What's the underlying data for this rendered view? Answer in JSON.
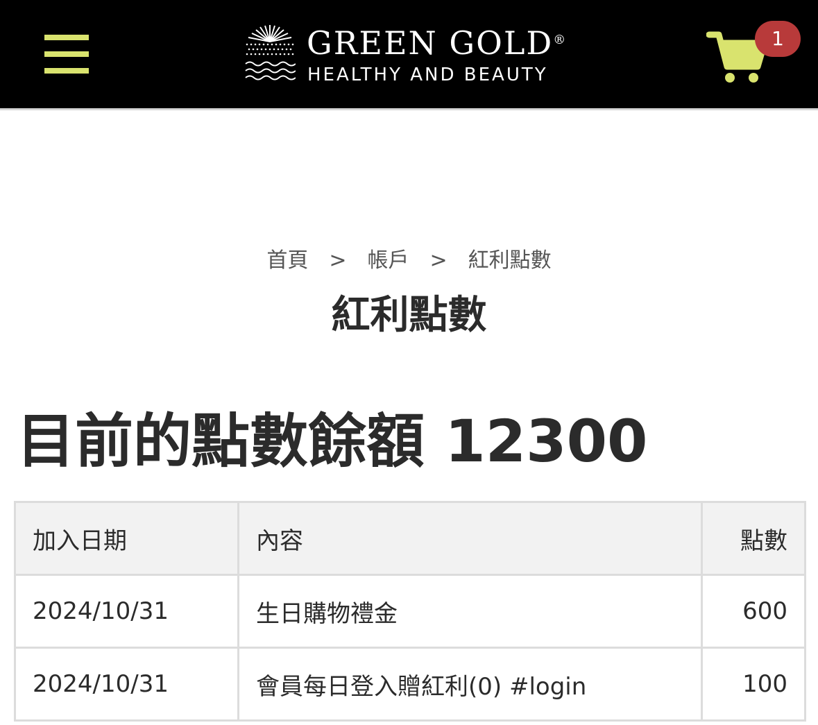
{
  "header": {
    "brand_name": "GREEN GOLD",
    "brand_registered": "®",
    "brand_tagline": "HEALTHY AND BEAUTY",
    "cart_count": "1",
    "menu_icon": "hamburger-menu-icon",
    "cart_icon": "shopping-cart-icon",
    "colors": {
      "background": "#000000",
      "accent": "#d9e36e",
      "badge": "#b83a3a"
    }
  },
  "breadcrumb": {
    "items": [
      "首頁",
      "帳戶",
      "紅利點數"
    ],
    "separator": ">"
  },
  "page_title": "紅利點數",
  "balance_label": "目前的點數餘額 12300",
  "table": {
    "headers": {
      "date": "加入日期",
      "content": "內容",
      "points": "點數"
    },
    "rows": [
      {
        "date": "2024/10/31",
        "content": "生日購物禮金",
        "points": "600"
      },
      {
        "date": "2024/10/31",
        "content": "會員每日登入贈紅利(0) #login",
        "points": "100"
      }
    ]
  }
}
